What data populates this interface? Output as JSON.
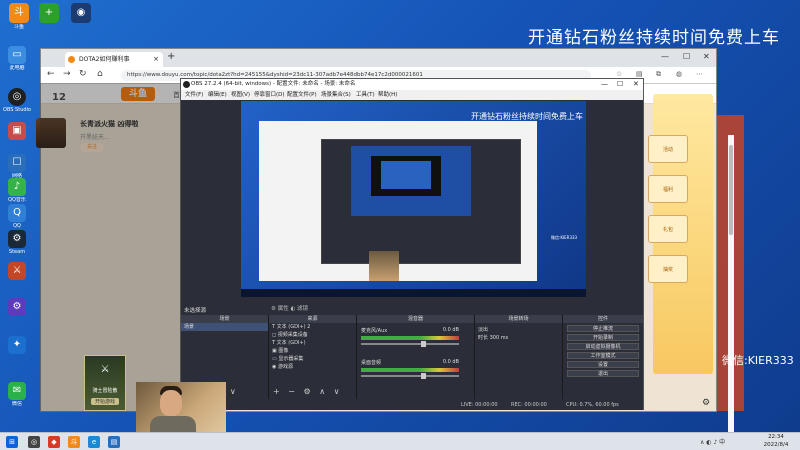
{
  "desktop": {
    "promo_text": "开通钻石粉丝持续时间免费上车",
    "wechat_text": "微信:KIER333",
    "top_icons": [
      {
        "label": "斗鱼",
        "icon": "douyu-icon",
        "color": "#f28a1a"
      },
      {
        "label": "",
        "icon": "add-icon",
        "color": "#2ca02c"
      },
      {
        "label": "",
        "icon": "camera-app-icon",
        "color": "#1c3b70"
      }
    ],
    "left_icons": [
      {
        "label": "此电脑",
        "icon": "computer-icon",
        "color": "#3b8de0"
      },
      {
        "label": "OBS Studio",
        "icon": "obs-icon",
        "color": "#202020"
      },
      {
        "label": "",
        "icon": "photo-icon",
        "color": "#c94c4c"
      },
      {
        "label": "网络",
        "icon": "network-icon",
        "color": "#2a6ebb"
      },
      {
        "label": "QQ音乐",
        "icon": "qq-music-icon",
        "color": "#35b34a"
      },
      {
        "label": "QQ",
        "icon": "qq-icon",
        "color": "#2f7fd6"
      },
      {
        "label": "Steam",
        "icon": "steam-icon",
        "color": "#1b2838"
      },
      {
        "label": "",
        "icon": "game-icon",
        "color": "#c34727"
      },
      {
        "label": "",
        "icon": "settings-app-icon",
        "color": "#5e3bbd"
      },
      {
        "label": "",
        "icon": "vpn-icon",
        "color": "#1b6fcf"
      },
      {
        "label": "微信",
        "icon": "wechat-icon",
        "color": "#2ab14a"
      }
    ]
  },
  "browser": {
    "tab_title": "DOTA2如何赚利事",
    "url": "https://www.douyu.com/topic/dota2zt?hd=245155&dyshid=23dc11-307adb7e448dbb74e17c2d000021601",
    "site": {
      "logo": "斗鱼",
      "nav": "首页",
      "rank_number": "12",
      "room_title": "长青派火猫 凶得啦",
      "room_sub": "开黑娃天…",
      "follow": "关注",
      "ad_labels": [
        "活动",
        "福利",
        "礼包",
        "抽奖"
      ]
    }
  },
  "obs": {
    "title": "OBS 27.2.4 (64-bit, windows) - 配置文件: 未命名 - 场景: 未命名",
    "menu": [
      "文件(F)",
      "编辑(E)",
      "视图(V)",
      "停靠窗口(D)",
      "配置文件(P)",
      "场景集合(S)",
      "工具(T)",
      "帮助(H)"
    ],
    "preview_promo": "开通钻石粉丝持续时间免费上车",
    "preview_caption": "微信:KIER333",
    "no_scene": "未选择源",
    "filters": "滤镜",
    "properties": "属性",
    "docks": {
      "scenes": {
        "title": "场景",
        "items": [
          "场景"
        ]
      },
      "sources": {
        "title": "来源",
        "items": [
          "文本 (GDI+) 2",
          "视频采集设备",
          "文本 (GDI+)",
          "图像",
          "显示器采集",
          "游戏源"
        ]
      },
      "mixer": {
        "title": "混音器",
        "tracks": [
          {
            "name": "麦克风/Aux",
            "db": "0.0 dB"
          },
          {
            "name": "桌面音频",
            "db": "0.0 dB"
          }
        ]
      },
      "transitions": {
        "title": "场景转场",
        "type": "淡出",
        "duration_label": "时长",
        "duration": "300 ms"
      },
      "controls": {
        "title": "控件",
        "buttons": [
          "停止推流",
          "开始录制",
          "启动虚拟摄像机",
          "工作室模式",
          "设置",
          "退出"
        ]
      }
    },
    "status": {
      "live": "LIVE: 00:00:00",
      "rec": "REC: 00:00:00",
      "cpu": "CPU: 0.7%, 60.00 fps"
    }
  },
  "gamecard": {
    "title": "骑士冒险散",
    "button": "开始游戏"
  },
  "taskbar": {
    "time": "22:34",
    "date": "2022/8/4"
  }
}
